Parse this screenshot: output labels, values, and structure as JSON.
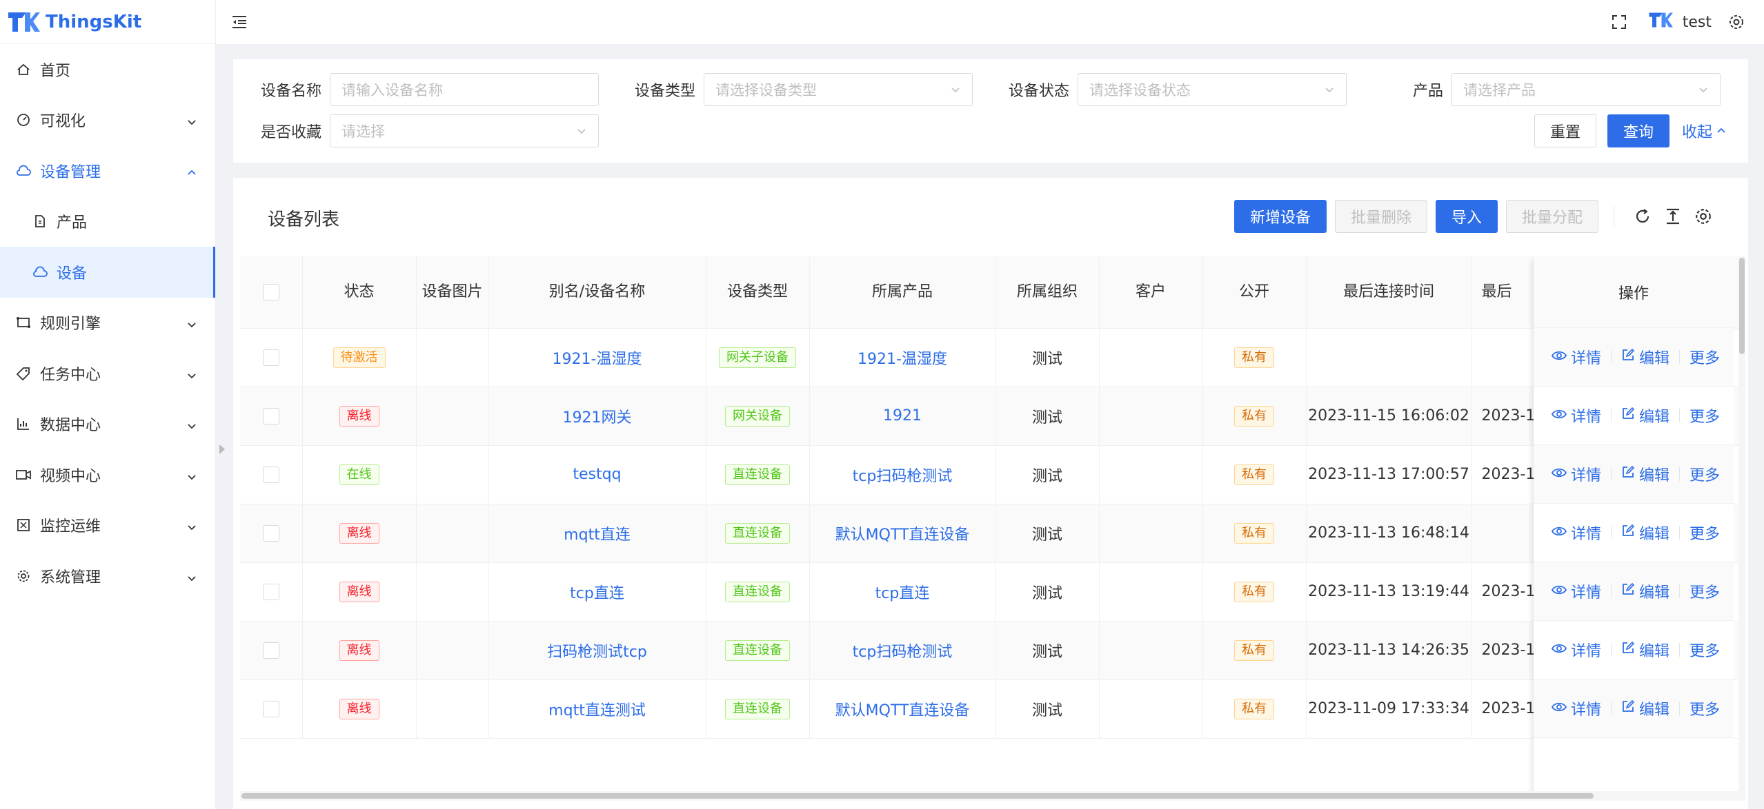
{
  "app": {
    "name": "ThingsKit",
    "brand_color": "#2d6ee8"
  },
  "sidebar": {
    "items": [
      {
        "label": "首页",
        "icon": "home-icon"
      },
      {
        "label": "可视化",
        "icon": "dashboard-icon"
      },
      {
        "label": "设备管理",
        "icon": "cloud-icon"
      },
      {
        "label": "产品",
        "icon": "file-icon"
      },
      {
        "label": "设备",
        "icon": "cloud-icon"
      },
      {
        "label": "规则引擎",
        "icon": "rule-icon"
      },
      {
        "label": "任务中心",
        "icon": "tag-icon"
      },
      {
        "label": "数据中心",
        "icon": "chart-icon"
      },
      {
        "label": "视频中心",
        "icon": "video-icon"
      },
      {
        "label": "监控运维",
        "icon": "monitor-icon"
      },
      {
        "label": "系统管理",
        "icon": "gear-icon"
      }
    ]
  },
  "header": {
    "user": "test"
  },
  "search": {
    "device_name": {
      "label": "设备名称",
      "placeholder": "请输入设备名称"
    },
    "device_type": {
      "label": "设备类型",
      "placeholder": "请选择设备类型"
    },
    "device_status": {
      "label": "设备状态",
      "placeholder": "请选择设备状态"
    },
    "product": {
      "label": "产品",
      "placeholder": "请选择产品"
    },
    "favorite": {
      "label": "是否收藏",
      "placeholder": "请选择"
    },
    "reset": "重置",
    "query": "查询",
    "collapse": "收起"
  },
  "table": {
    "title": "设备列表",
    "buttons": {
      "add": "新增设备",
      "batch_delete": "批量删除",
      "import": "导入",
      "batch_assign": "批量分配"
    },
    "columns": [
      "状态",
      "设备图片",
      "别名/设备名称",
      "设备类型",
      "所属产品",
      "所属组织",
      "客户",
      "公开",
      "最后连接时间",
      "最后",
      "操作"
    ],
    "rows": [
      {
        "status": "待激活",
        "name": "1921-温湿度",
        "type": "网关子设备",
        "product": "1921-温湿度",
        "org": "测试",
        "public": "私有",
        "last_connect": "",
        "last2": ""
      },
      {
        "status": "离线",
        "name": "1921网关",
        "type": "网关设备",
        "product": "1921",
        "org": "测试",
        "public": "私有",
        "last_connect": "2023-11-15 16:06:02",
        "last2": "2023-1"
      },
      {
        "status": "在线",
        "name": "testqq",
        "type": "直连设备",
        "product": "tcp扫码枪测试",
        "org": "测试",
        "public": "私有",
        "last_connect": "2023-11-13 17:00:57",
        "last2": "2023-1"
      },
      {
        "status": "离线",
        "name": "mqtt直连",
        "type": "直连设备",
        "product": "默认MQTT直连设备",
        "org": "测试",
        "public": "私有",
        "last_connect": "2023-11-13 16:48:14",
        "last2": ""
      },
      {
        "status": "离线",
        "name": "tcp直连",
        "type": "直连设备",
        "product": "tcp直连",
        "org": "测试",
        "public": "私有",
        "last_connect": "2023-11-13 13:19:44",
        "last2": "2023-1"
      },
      {
        "status": "离线",
        "name": "扫码枪测试tcp",
        "type": "直连设备",
        "product": "tcp扫码枪测试",
        "org": "测试",
        "public": "私有",
        "last_connect": "2023-11-13 14:26:35",
        "last2": "2023-1"
      },
      {
        "status": "离线",
        "name": "mqtt直连测试",
        "type": "直连设备",
        "product": "默认MQTT直连设备",
        "org": "测试",
        "public": "私有",
        "last_connect": "2023-11-09 17:33:34",
        "last2": "2023-1"
      }
    ],
    "actions": {
      "detail": "详情",
      "edit": "编辑",
      "more": "更多"
    }
  }
}
